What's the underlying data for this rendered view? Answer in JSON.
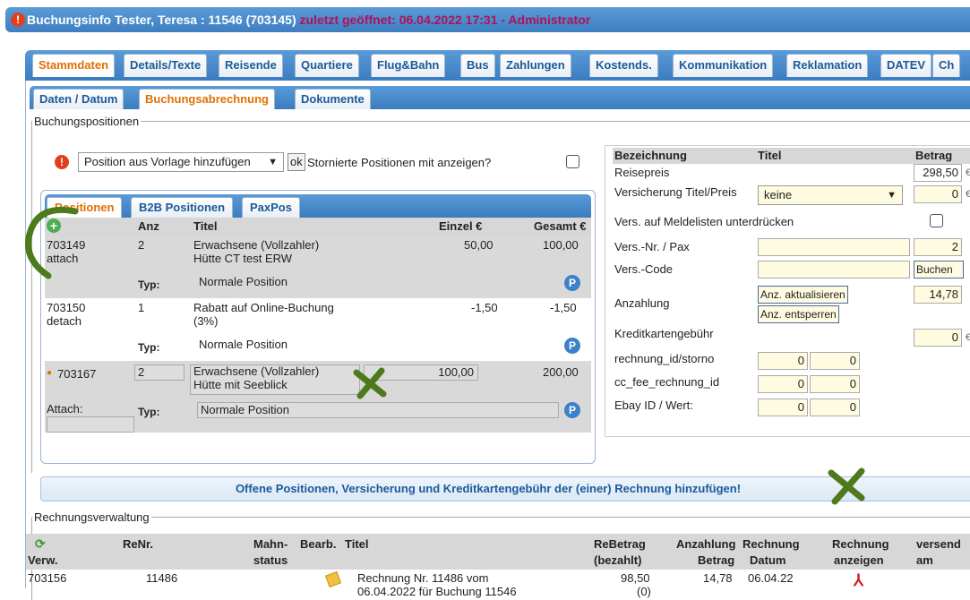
{
  "window": {
    "title": "Buchungsinfo Tester, Teresa : 11546 (703145)",
    "opened": "zuletzt geöffnet: 06.04.2022 17:31",
    "separator": " - ",
    "role": "Administrator"
  },
  "main_tabs": [
    "Stammdaten",
    "Details/Texte",
    "Reisende",
    "Quartiere",
    "Flug&Bahn",
    "Bus",
    "Zahlungen",
    "Kostends.",
    "Kommunikation",
    "Reklamation",
    "DATEV",
    "Ch"
  ],
  "sub_tabs": [
    "Daten / Datum",
    "Buchungsabrechnung",
    "Dokumente"
  ],
  "buchungspositionen": {
    "legend": "Buchungspositionen",
    "template_select": "Position aus Vorlage hinzufügen",
    "ok_label": "ok",
    "storniert_label": "Stornierte Positionen mit anzeigen?"
  },
  "inner_tabs": [
    "Positionen",
    "B2B Positionen",
    "PaxPos"
  ],
  "positions_header": {
    "anz": "Anz",
    "titel": "Titel",
    "einzel": "Einzel €",
    "gesamt": "Gesamt €"
  },
  "positions": [
    {
      "id": "703149",
      "sub": "attach",
      "anz": "2",
      "titel1": "Erwachsene (Vollzahler)",
      "titel2": "Hütte CT test ERW",
      "einzel": "50,00",
      "gesamt": "100,00",
      "typ_label": "Typ:",
      "typ": "Normale Position"
    },
    {
      "id": "703150",
      "sub": "detach",
      "anz": "1",
      "titel1": "Rabatt auf Online-Buchung",
      "titel2": "(3%)",
      "einzel": "-1,50",
      "gesamt": "-1,50",
      "typ_label": "Typ:",
      "typ": "Normale Position"
    },
    {
      "id": "703167",
      "sub": "Attach:",
      "anz": "2",
      "titel1": "Erwachsene (Vollzahler)",
      "titel2": "Hütte mit Seeblick",
      "einzel": "100,00",
      "gesamt": "200,00",
      "typ_label": "Typ:",
      "typ": "Normale Position"
    }
  ],
  "right_table": {
    "header": {
      "bezeichnung": "Bezeichnung",
      "titel": "Titel",
      "betrag": "Betrag"
    },
    "reisepreis_label": "Reisepreis",
    "reisepreis_value": "298,50",
    "versicherung_label": "Versicherung Titel/Preis",
    "versicherung_select": "keine",
    "versicherung_value": "0",
    "meldelisten_label": "Vers. auf Meldelisten unterdrücken",
    "versnr_label": "Vers.-Nr. / Pax",
    "versnr_value": "2",
    "verscode_label": "Vers.-Code",
    "buchen_label": "Buchen",
    "anzahlung_label": "Anzahlung",
    "anz_aktualisieren": "Anz. aktualisieren",
    "anz_entsperren": "Anz. entsperren",
    "anzahlung_value": "14,78",
    "kreditkarte_label": "Kreditkartengebühr",
    "kreditkarte_value": "0",
    "rechnung_storno_label": "rechnung_id/storno",
    "rechnung_storno_1": "0",
    "rechnung_storno_2": "0",
    "ccfee_label": "cc_fee_rechnung_id",
    "ccfee_1": "0",
    "ccfee_2": "0",
    "ebay_label": "Ebay ID / Wert:",
    "ebay_1": "0",
    "ebay_2": "0"
  },
  "info_bar": "Offene Positionen, Versicherung und Kreditkartengebühr der (einer) Rechnung hinzufügen!",
  "rechnungsverwaltung": {
    "legend": "Rechnungsverwaltung",
    "headers": {
      "verw": "Verw.",
      "renr": "ReNr.",
      "mahn1": "Mahn-",
      "mahn2": "status",
      "bearb": "Bearb.",
      "titel": "Titel",
      "rebetrag1": "ReBetrag",
      "rebetrag2": "(bezahlt)",
      "anzahlung1": "Anzahlung",
      "anzahlung2": "Betrag",
      "rechnung1": "Rechnung",
      "rechnung2": "Datum",
      "anzeigen1": "Rechnung",
      "anzeigen2": "anzeigen",
      "versendet1": "versend",
      "versendet2": "am"
    },
    "row": {
      "verw": "703156",
      "renr": "11486",
      "titel1": "Rechnung Nr. 11486 vom",
      "titel2": "06.04.2022 für Buchung 11546",
      "rebetrag": "98,50",
      "rebetrag2": "(0)",
      "anzahlung": "14,78",
      "datum": "06.04.22"
    }
  },
  "colors": {
    "accent": "#e07000",
    "tab_text": "#1a5a9a",
    "bar": "#3b7cc0",
    "title_alert": "#b0105a"
  },
  "icons": [
    "alert-icon",
    "add-circle-icon",
    "p-icon",
    "pdf-icon",
    "edit-icon",
    "refresh-icon",
    "dropdown-arrow-icon"
  ]
}
